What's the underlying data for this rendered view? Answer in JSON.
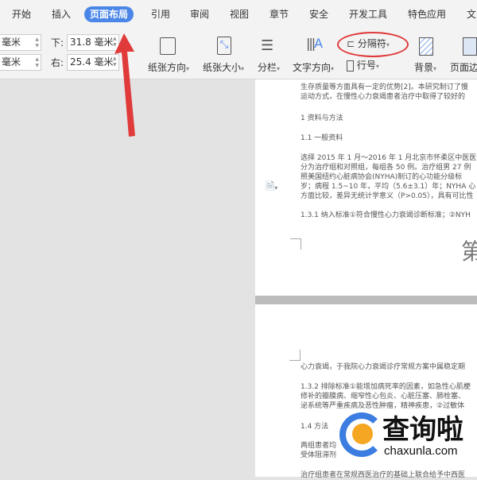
{
  "tabs": [
    {
      "label": "开始"
    },
    {
      "label": "插入"
    },
    {
      "label": "页面布局",
      "active": true
    },
    {
      "label": "引用"
    },
    {
      "label": "审阅"
    },
    {
      "label": "视图"
    },
    {
      "label": "章节"
    },
    {
      "label": "安全"
    },
    {
      "label": "开发工具"
    },
    {
      "label": "特色应用"
    },
    {
      "label": "文"
    }
  ],
  "margins": {
    "top_left_unit": "毫米",
    "bottom_left_unit": "毫米",
    "bottom_label": "下:",
    "bottom_value": "31.8 毫米",
    "right_label": "右:",
    "right_value": "25.4 毫米"
  },
  "ribbon": {
    "orientation": "纸张方向",
    "size": "纸张大小",
    "columns": "分栏",
    "text_direction": "文字方向",
    "breaks": "分隔符",
    "line_numbers": "行号",
    "background": "背景",
    "page_border": "页面边"
  },
  "document": {
    "page1_lines": [
      "生存质量等方面具有一定的优势[2]。本研究制订了慢",
      "运动方式，在慢性心力衰竭患者治疗中取得了较好的",
      "1 资料与方法",
      "1.1 一般资料",
      "选择 2015 年 1 月～2016 年 1 月北京市怀柔区中医医",
      "分为治疗组和对照组，每组各 50 例。治疗组男 27 例",
      "照美国纽约心脏病协会(NYHA)制订的心功能分级标",
      "岁；病程 1.5~10 年，平均（5.6±3.1）年；NYHA 心",
      "方面比较，差异无统计学意义（P>0.05），具有可比性",
      "1.3.1 纳入标准①符合慢性心力衰竭诊断标准；②NYH"
    ],
    "page1_footer_char": "第",
    "page2_lines": [
      "心力衰竭，于我院心力衰竭诊疗常规方案中属稳定期",
      "1.3.2 排除标准①能增加病死率的因素，如急性心肌梗",
      "修补的瓣膜病、缩窄性心包炎、心脏压塞、肺栓塞、",
      "泌系统等严重疾病及恶性肿瘤，精神疾患，②过敏体",
      "1.4 方法",
      "两组患者均",
      "受体阻滞剂",
      "治疗组患者在常规西医治疗的基础上联合给予中西医"
    ]
  },
  "watermark": {
    "text": "查询啦",
    "url": "chaxunla.com"
  },
  "colors": {
    "accent": "#4a86e8",
    "annotation": "#e03a3a"
  }
}
